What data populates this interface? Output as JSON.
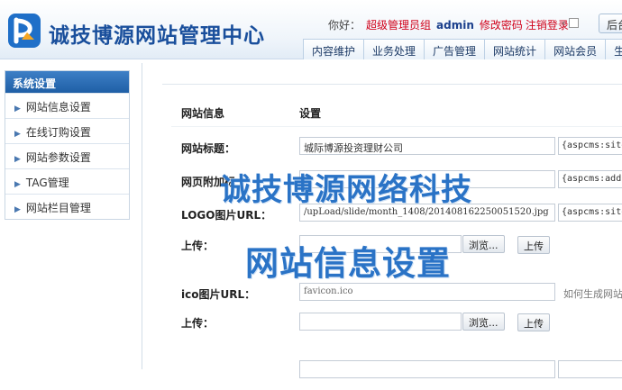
{
  "header": {
    "brand": "诚技博源网站管理中心",
    "greeting": "你好：",
    "group": "超级管理员组",
    "username": "admin",
    "change_password": "修改密码",
    "logout": "注销登录",
    "home_button": "后台",
    "logo_color": "#1f6fc8"
  },
  "nav": {
    "tabs": [
      "内容维护",
      "业务处理",
      "广告管理",
      "网站统计",
      "网站会员",
      "生成"
    ]
  },
  "sidebar": {
    "title": "系统设置",
    "items": [
      "网站信息设置",
      "在线订购设置",
      "网站参数设置",
      "TAG管理",
      "网站栏目管理"
    ]
  },
  "main": {
    "col_header_1": "网站信息",
    "col_header_2": "设置",
    "rows": [
      {
        "label": "网站标题：",
        "value": "城际博源投资理财公司",
        "tag": "{aspcms:sitetitle}"
      },
      {
        "label": "网页附加标",
        "value": "",
        "tag": "{aspcms:additiontitle}"
      },
      {
        "label": "LOGO图片URL：",
        "value": "/upLoad/slide/month_1408/201408162250051520.jpg",
        "tag": "{aspcms:sitelogo}"
      },
      {
        "label": "上传：",
        "browse": "浏览...",
        "upload": "上传"
      },
      {
        "label": "ico图片URL：",
        "value": "favicon.ico",
        "hint": "如何生成网站"
      },
      {
        "label": "上传：",
        "browse": "浏览...",
        "upload": "上传"
      }
    ]
  },
  "watermark": {
    "line1": "诚技博源网络科技",
    "line2": "网站信息设置"
  },
  "colors": {
    "brand": "#1a4f9c",
    "accent_red": "#d0021b",
    "sidebar_title": "#2b6cb4",
    "watermark": "#2a73c6"
  }
}
